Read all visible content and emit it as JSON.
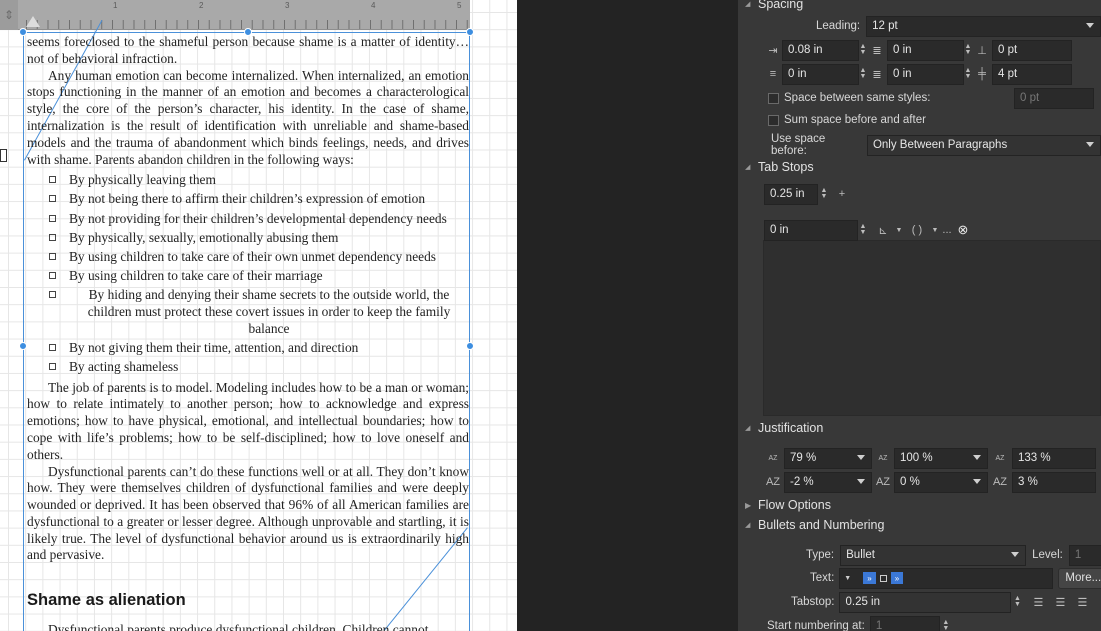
{
  "ruler": {
    "corner": "⇕",
    "numbers": [
      "1",
      "2",
      "3",
      "4",
      "5"
    ]
  },
  "document": {
    "p1": "seems foreclosed to the shameful person because shame is a matter of identity…not of behavioral infraction.",
    "p2": "Any human emotion can become internalized. When internalized, an emotion stops functioning in the manner of an emotion and becomes a characterological style, the core of the person’s character, his identity. In the case of shame, internalization is the result of identification with unreliable and shame-based models and the trauma of abandonment which binds feelings, needs, and drives with shame. Parents abandon children in the following ways:",
    "bullets": [
      "By physically leaving them",
      "By not being there to affirm their children’s expression of emotion",
      "By not providing for their children’s developmental dependency needs",
      "By physically, sexually, emotionally abusing them",
      "By using children to take care of their own unmet dependency needs",
      "By using children to take care of their marriage",
      "By hiding and denying their shame secrets to the outside world, the children must protect these covert issues in order to keep the family balance",
      "By not giving them their time, attention, and direction",
      "By acting shameless"
    ],
    "p3": "The job of parents is to model. Modeling includes how to be a man or woman; how to relate intimately to another person; how to acknowledge and express emotions; how to have physical, emotional, and intellectual boundaries; how to cope with life’s problems; how to be self-disciplined; how to love oneself and others.",
    "p4": "Dysfunctional parents can’t do these functions well or at all. They don’t know how. They were themselves children of dysfunctional families and were deeply wounded or deprived. It has been observed that 96% of all American families are dysfunctional to a greater or lesser degree. Although unprovable and startling, it is likely true. The level of dysfunctional behavior around us is extraordinarily high and pervasive.",
    "heading": "Shame as alienation",
    "p5": "Dysfunctional parents produce dysfunctional children. Children cannot"
  },
  "panel": {
    "spacing": {
      "title": "Spacing",
      "leading_label": "Leading:",
      "leading": "12 pt",
      "left_indent": "0.08 in",
      "first_line_indent": "0 in",
      "space_before": "0 pt",
      "right_indent": "0 in",
      "last_line_indent": "0 in",
      "space_after": "4 pt",
      "space_between_label": "Space between same styles:",
      "space_between_value": "0 pt",
      "sum_space_label": "Sum space before and after",
      "use_space_label": "Use space before:",
      "use_space_value": "Only Between Paragraphs"
    },
    "tab_stops": {
      "title": "Tab Stops",
      "default_tab": "0.25 in",
      "add_icon": "+",
      "tab_position": "0 in",
      "align_icon": "⊾",
      "paren_icon": "( )",
      "more": "..."
    },
    "justification": {
      "title": "Justification",
      "min_word": "79 %",
      "desired_word": "100 %",
      "max_word": "133 %",
      "min_letter": "-2 %",
      "desired_letter": "0 %",
      "max_letter": "3 %"
    },
    "flow_options": {
      "title": "Flow Options"
    },
    "bullets": {
      "title": "Bullets and Numbering",
      "type_label": "Type:",
      "type_value": "Bullet",
      "level_label": "Level:",
      "level_value": "1",
      "text_label": "Text:",
      "chip1": "»",
      "chip2": "»",
      "more": "More...",
      "tabstop_label": "Tabstop:",
      "tabstop_value": "0.25 in",
      "start_label": "Start numbering at:",
      "start_value": "1"
    }
  },
  "colors": {
    "accent": "#3d8ee0",
    "panel_bg": "#383838",
    "field_bg": "#2a2a2a"
  }
}
